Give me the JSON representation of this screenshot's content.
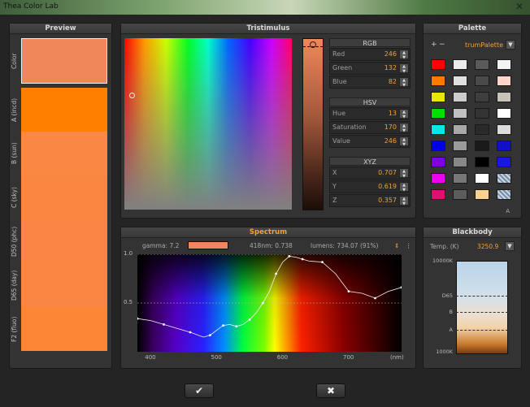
{
  "window": {
    "title": "Thea Color Lab"
  },
  "preview": {
    "title": "Preview",
    "rows": [
      {
        "label": "Color",
        "color": "#f0875a"
      },
      {
        "label": "A (incd)",
        "color": "#ff8000"
      },
      {
        "label": "B (sun)",
        "color": "#fb8745"
      },
      {
        "label": "C (sky)",
        "color": "#fb8642"
      },
      {
        "label": "D50 (phc)",
        "color": "#fb8544"
      },
      {
        "label": "D65 (day)",
        "color": "#fb8542"
      },
      {
        "label": "F2 (fluo)",
        "color": "#fc8636"
      }
    ]
  },
  "tristimulus": {
    "title": "Tristimulus",
    "rgb": {
      "title": "RGB",
      "fields": [
        {
          "label": "Red",
          "value": "246"
        },
        {
          "label": "Green",
          "value": "132"
        },
        {
          "label": "Blue",
          "value": "82"
        }
      ]
    },
    "hsv": {
      "title": "HSV",
      "fields": [
        {
          "label": "Hue",
          "value": "13"
        },
        {
          "label": "Saturation",
          "value": "170"
        },
        {
          "label": "Value",
          "value": "246"
        }
      ]
    },
    "xyz": {
      "title": "XYZ",
      "fields": [
        {
          "label": "X",
          "value": "0.707"
        },
        {
          "label": "Y",
          "value": "0.619"
        },
        {
          "label": "Z",
          "value": "0.357"
        }
      ]
    }
  },
  "palette": {
    "title": "Palette",
    "add": "+",
    "remove": "−",
    "name": "trumPalette",
    "dropdown": "▼",
    "footer": "A",
    "swatches": [
      [
        "#ff0000",
        "#ececec",
        "#5a5a5a",
        "#f4f4f4"
      ],
      [
        "#ff7a00",
        "#e0e0e0",
        "#4a4a4a",
        "#ffd6c8"
      ],
      [
        "#e8e800",
        "#cccccc",
        "#3e3e3e",
        "#c8c4ba"
      ],
      [
        "#00e000",
        "#c0c0c0",
        "#333333",
        "#ffffff"
      ],
      [
        "#00e8e8",
        "#a8a8a8",
        "#2a2a2a",
        "#dcdcdc"
      ],
      [
        "#0000e8",
        "#9a9a9a",
        "#1a1a1a",
        "#1010c8"
      ],
      [
        "#8000e0",
        "#888888",
        "#000000",
        "#1818e0"
      ],
      [
        "#f000f0",
        "#777777",
        "#ffffff",
        "hatch"
      ],
      [
        "#e01070",
        "#5c5c5c",
        "#f8d090",
        "hatch"
      ]
    ]
  },
  "spectrum": {
    "title": "Spectrum",
    "gamma_label": "gamma: 7.2",
    "dominant": "418nm: 0.738",
    "lumens": "lumens: 734.07 (91%)",
    "icons": [
      "adjust-icon",
      "menu-dots-icon"
    ]
  },
  "chart_data": {
    "type": "line",
    "title": "",
    "xlabel": "(nm)",
    "ylabel": "",
    "xlim": [
      380,
      780
    ],
    "ylim": [
      0,
      1
    ],
    "xticks": [
      "400",
      "500",
      "600",
      "700",
      "(nm)"
    ],
    "yticks": [
      "1.0",
      "0.5"
    ],
    "series": [
      {
        "x": [
          380,
          400,
          420,
          440,
          460,
          480,
          490,
          500,
          510,
          520,
          530,
          540,
          550,
          560,
          570,
          580,
          590,
          600,
          610,
          620,
          630,
          640,
          660,
          680,
          700,
          720,
          740,
          760,
          780
        ],
        "y": [
          0.34,
          0.32,
          0.28,
          0.24,
          0.2,
          0.15,
          0.17,
          0.22,
          0.27,
          0.28,
          0.26,
          0.28,
          0.33,
          0.4,
          0.5,
          0.62,
          0.8,
          0.92,
          0.98,
          0.97,
          0.95,
          0.93,
          0.92,
          0.8,
          0.62,
          0.6,
          0.55,
          0.62,
          0.66
        ]
      }
    ]
  },
  "blackbody": {
    "title": "Blackbody",
    "temp_label": "Temp. (K)",
    "temp_value": "3250.9",
    "dropdown": "▼",
    "ticks": [
      "10000K",
      "D65",
      "B",
      "A",
      "1000K"
    ]
  },
  "buttons": {
    "ok": "✔",
    "cancel": "✖"
  }
}
